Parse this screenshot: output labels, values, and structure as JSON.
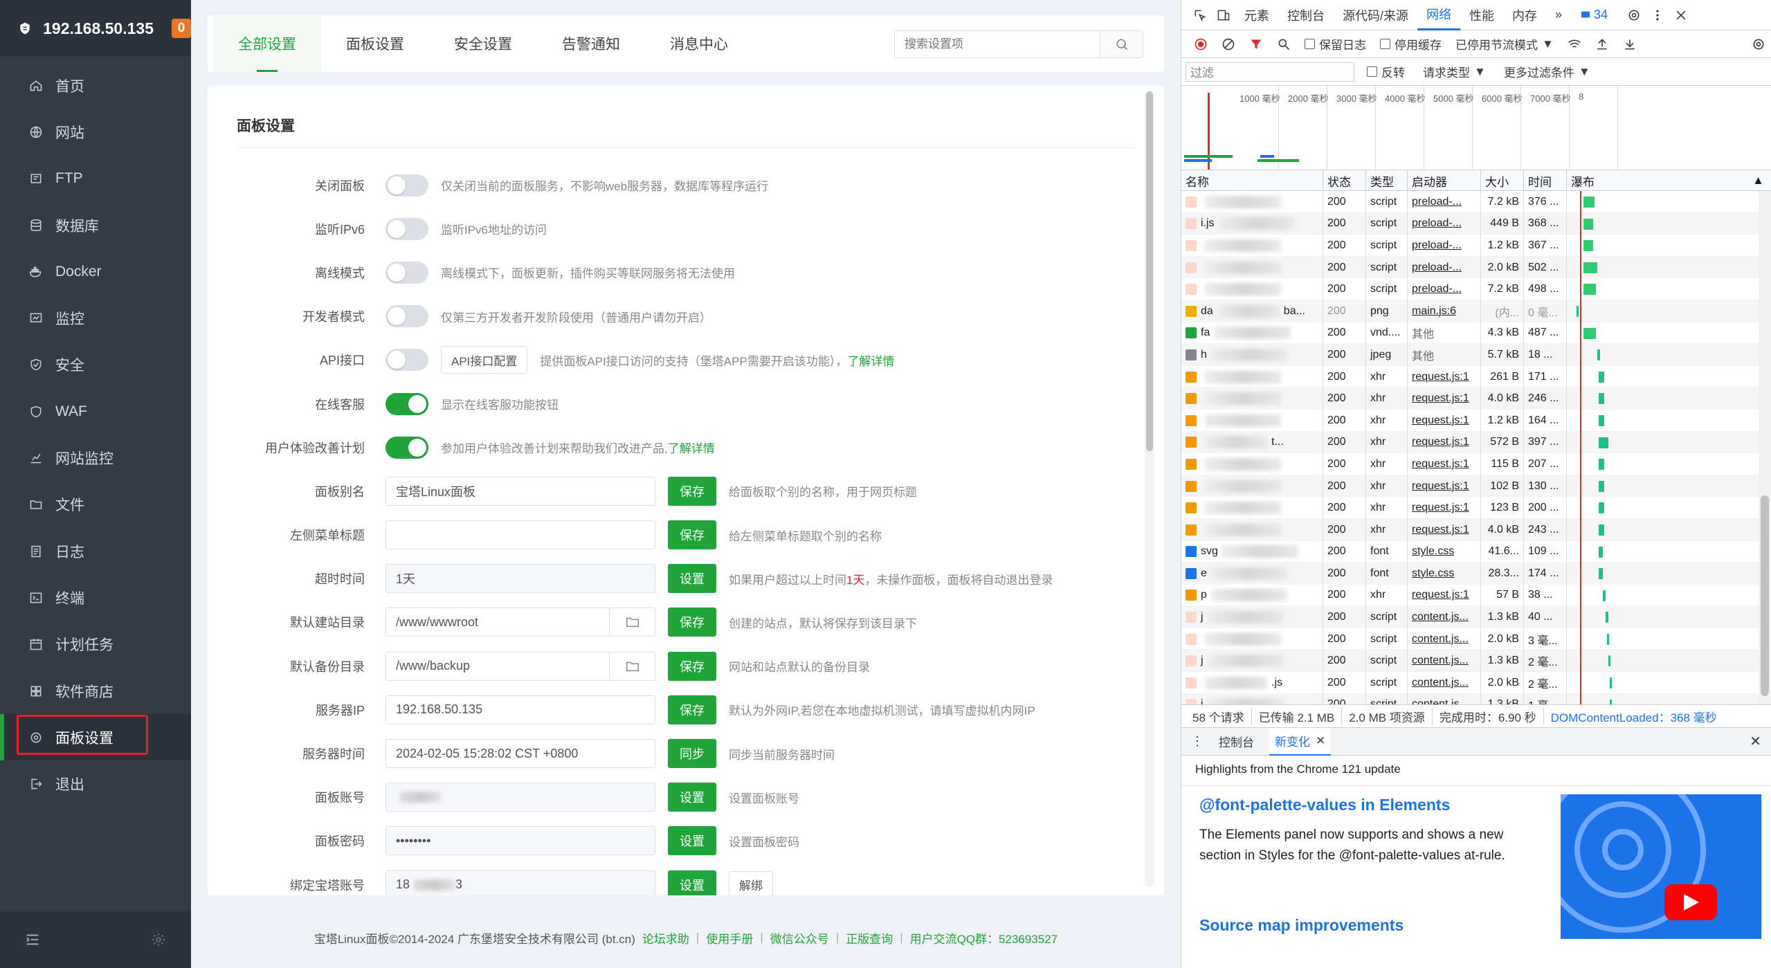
{
  "sidebar": {
    "ip": "192.168.50.135",
    "badge": "0",
    "items": [
      {
        "label": "首页",
        "icon": "home-icon"
      },
      {
        "label": "网站",
        "icon": "globe-icon"
      },
      {
        "label": "FTP",
        "icon": "ftp-icon"
      },
      {
        "label": "数据库",
        "icon": "database-icon"
      },
      {
        "label": "Docker",
        "icon": "docker-icon"
      },
      {
        "label": "监控",
        "icon": "monitor-icon"
      },
      {
        "label": "安全",
        "icon": "shield-icon"
      },
      {
        "label": "WAF",
        "icon": "waf-icon"
      },
      {
        "label": "网站监控",
        "icon": "chart-icon"
      },
      {
        "label": "文件",
        "icon": "folder-icon"
      },
      {
        "label": "日志",
        "icon": "log-icon"
      },
      {
        "label": "终端",
        "icon": "terminal-icon"
      },
      {
        "label": "计划任务",
        "icon": "calendar-icon"
      },
      {
        "label": "软件商店",
        "icon": "store-icon"
      },
      {
        "label": "面板设置",
        "icon": "gear-icon"
      },
      {
        "label": "退出",
        "icon": "logout-icon"
      }
    ]
  },
  "header": {
    "tabs": [
      "全部设置",
      "面板设置",
      "安全设置",
      "告警通知",
      "消息中心"
    ],
    "search_placeholder": "搜索设置项"
  },
  "panel": {
    "title": "面板设置",
    "close_panel": {
      "label": "关闭面板",
      "desc": "仅关闭当前的面板服务，不影响web服务器，数据库等程序运行"
    },
    "ipv6": {
      "label": "监听IPv6",
      "desc": "监听IPv6地址的访问"
    },
    "offline": {
      "label": "离线模式",
      "desc": "离线模式下，面板更新，插件购买等联网服务将无法使用"
    },
    "dev": {
      "label": "开发者模式",
      "desc": "仅第三方开发者开发阶段使用（普通用户请勿开启）"
    },
    "api": {
      "label": "API接口",
      "button": "API接口配置",
      "desc": "提供面板API接口访问的支持（堡塔APP需要开启该功能），",
      "link": "了解详情"
    },
    "online_service": {
      "label": "在线客服",
      "desc": "显示在线客服功能按钮"
    },
    "ux_plan": {
      "label": "用户体验改善计划",
      "desc": "参加用户体验改善计划来帮助我们改进产品,",
      "link": "了解详情"
    },
    "alias": {
      "label": "面板别名",
      "value": "宝塔Linux面板",
      "button": "保存",
      "desc": "给面板取个别的名称，用于网页标题"
    },
    "menu_title": {
      "label": "左侧菜单标题",
      "value": "",
      "button": "保存",
      "desc": "给左侧菜单标题取个别的名称"
    },
    "timeout": {
      "label": "超时时间",
      "value": "1天",
      "button": "设置",
      "desc_a": "如果用户超过以上时间",
      "desc_red": "1天",
      "desc_b": "，未操作面板，面板将自动退出登录"
    },
    "site_dir": {
      "label": "默认建站目录",
      "value": "/www/wwwroot",
      "button": "保存",
      "desc": "创建的站点，默认将保存到该目录下"
    },
    "backup_dir": {
      "label": "默认备份目录",
      "value": "/www/backup",
      "button": "保存",
      "desc": "网站和站点默认的备份目录"
    },
    "server_ip": {
      "label": "服务器IP",
      "value": "192.168.50.135",
      "button": "保存",
      "desc": "默认为外网IP,若您在本地虚拟机测试，请填写虚拟机内网IP"
    },
    "server_time": {
      "label": "服务器时间",
      "value": "2024-02-05 15:28:02 CST +0800",
      "button": "同步",
      "desc": "同步当前服务器时间"
    },
    "account": {
      "label": "面板账号",
      "value": "",
      "button": "设置",
      "desc": "设置面板账号"
    },
    "password": {
      "label": "面板密码",
      "value": "••••••••",
      "button": "设置",
      "desc": "设置面板密码"
    },
    "bind": {
      "label": "绑定宝塔账号",
      "value": "18",
      "value_tail": "3",
      "button": "设置",
      "button2": "解绑"
    }
  },
  "footer": {
    "copyright": "宝塔Linux面板©2014-2024 广东堡塔安全技术有限公司 (bt.cn)",
    "links": [
      "论坛求助",
      "使用手册",
      "微信公众号",
      "正版查询"
    ],
    "qq": "用户交流QQ群：523693527"
  },
  "devtools": {
    "tabs": [
      "元素",
      "控制台",
      "源代码/来源",
      "网络",
      "性能",
      "内存"
    ],
    "issues_count": "34",
    "toolbar": {
      "preserve_log": "保留日志",
      "disable_cache": "停用缓存",
      "throttle": "已停用节流模式"
    },
    "filter": {
      "placeholder": "过滤",
      "invert": "反转",
      "request_type": "请求类型",
      "more_filters": "更多过滤条件"
    },
    "timeline_labels": [
      "1000 毫秒",
      "2000 毫秒",
      "3000 毫秒",
      "4000 毫秒",
      "5000 毫秒",
      "6000 毫秒",
      "7000 毫秒",
      "8"
    ],
    "columns": [
      "名称",
      "状态",
      "类型",
      "启动器",
      "大小",
      "时间",
      "瀑布"
    ],
    "rows": [
      {
        "name": "",
        "status": "200",
        "type": "script",
        "initiator": "preload-...",
        "size": "7.2 kB",
        "time": "376 ...",
        "icon": "#ffd6cc"
      },
      {
        "name": "i.js",
        "status": "200",
        "type": "script",
        "initiator": "preload-...",
        "size": "449 B",
        "time": "368 ...",
        "icon": "#ffd6cc"
      },
      {
        "name": "",
        "status": "200",
        "type": "script",
        "initiator": "preload-...",
        "size": "1.2 kB",
        "time": "367 ...",
        "icon": "#ffd6cc"
      },
      {
        "name": "",
        "status": "200",
        "type": "script",
        "initiator": "preload-...",
        "size": "2.0 kB",
        "time": "502 ...",
        "icon": "#ffd6cc"
      },
      {
        "name": "",
        "status": "200",
        "type": "script",
        "initiator": "preload-...",
        "size": "7.2 kB",
        "time": "498 ...",
        "icon": "#ffd6cc"
      },
      {
        "name": "da",
        "name_tail": "ba...",
        "status": "200",
        "type": "png",
        "initiator": "main.js:6",
        "size": "(内...",
        "time": "0 毫...",
        "icon": "#f9ab00",
        "gray": true
      },
      {
        "name": "fa",
        "status": "200",
        "type": "vnd....",
        "initiator": "其他",
        "size": "4.3 kB",
        "time": "487 ...",
        "icon": "#20a53a"
      },
      {
        "name": "h",
        "status": "200",
        "type": "jpeg",
        "initiator": "其他",
        "size": "5.7 kB",
        "time": "18 ...",
        "icon": "#80868b"
      },
      {
        "name": "",
        "status": "200",
        "type": "xhr",
        "initiator": "request.js:1",
        "size": "261 B",
        "time": "171 ...",
        "icon": "#f29900"
      },
      {
        "name": "",
        "status": "200",
        "type": "xhr",
        "initiator": "request.js:1",
        "size": "4.0 kB",
        "time": "246 ...",
        "icon": "#f29900"
      },
      {
        "name": "",
        "status": "200",
        "type": "xhr",
        "initiator": "request.js:1",
        "size": "1.2 kB",
        "time": "164 ...",
        "icon": "#f29900"
      },
      {
        "name": "",
        "name_tail": "t...",
        "status": "200",
        "type": "xhr",
        "initiator": "request.js:1",
        "size": "572 B",
        "time": "397 ...",
        "icon": "#f29900"
      },
      {
        "name": "",
        "status": "200",
        "type": "xhr",
        "initiator": "request.js:1",
        "size": "115 B",
        "time": "207 ...",
        "icon": "#f29900"
      },
      {
        "name": "",
        "status": "200",
        "type": "xhr",
        "initiator": "request.js:1",
        "size": "102 B",
        "time": "130 ...",
        "icon": "#f29900"
      },
      {
        "name": "",
        "status": "200",
        "type": "xhr",
        "initiator": "request.js:1",
        "size": "123 B",
        "time": "200 ...",
        "icon": "#f29900"
      },
      {
        "name": "",
        "status": "200",
        "type": "xhr",
        "initiator": "request.js:1",
        "size": "4.0 kB",
        "time": "243 ...",
        "icon": "#f29900"
      },
      {
        "name": "svg",
        "status": "200",
        "type": "font",
        "initiator": "style.css",
        "size": "41.6...",
        "time": "109 ...",
        "icon": "#1a73e8"
      },
      {
        "name": "e",
        "status": "200",
        "type": "font",
        "initiator": "style.css",
        "size": "28.3...",
        "time": "174 ...",
        "icon": "#1a73e8"
      },
      {
        "name": "p",
        "status": "200",
        "type": "xhr",
        "initiator": "request.js:1",
        "size": "57 B",
        "time": "38 ...",
        "icon": "#f29900"
      },
      {
        "name": "j",
        "status": "200",
        "type": "script",
        "initiator": "content.js...",
        "size": "1.3 kB",
        "time": "40 ...",
        "icon": "#ffd6cc"
      },
      {
        "name": "",
        "status": "200",
        "type": "script",
        "initiator": "content.js...",
        "size": "2.0 kB",
        "time": "3 毫...",
        "icon": "#ffd6cc"
      },
      {
        "name": "j",
        "status": "200",
        "type": "script",
        "initiator": "content.js...",
        "size": "1.3 kB",
        "time": "2 毫...",
        "icon": "#ffd6cc"
      },
      {
        "name": "",
        "name_tail": ".js",
        "status": "200",
        "type": "script",
        "initiator": "content.js...",
        "size": "2.0 kB",
        "time": "2 毫...",
        "icon": "#ffd6cc"
      },
      {
        "name": "j",
        "status": "200",
        "type": "script",
        "initiator": "content.js...",
        "size": "1.3 kB",
        "time": "1 毫...",
        "icon": "#ffd6cc"
      }
    ],
    "status_bar": {
      "requests": "58 个请求",
      "transferred": "已传输 2.1 MB",
      "resources": "2.0 MB 项资源",
      "finish": "完成用时：6.90 秒",
      "dcl": "DOMContentLoaded：368 毫秒"
    },
    "drawer": {
      "tab_console": "控制台",
      "tab_whats_new": "新变化",
      "highlights": "Highlights from the Chrome 121 update",
      "headline1": "@font-palette-values in Elements",
      "body1": "The Elements panel now supports and shows a new section in Styles for the @font-palette-values at-rule.",
      "headline2": "Source map improvements"
    }
  }
}
